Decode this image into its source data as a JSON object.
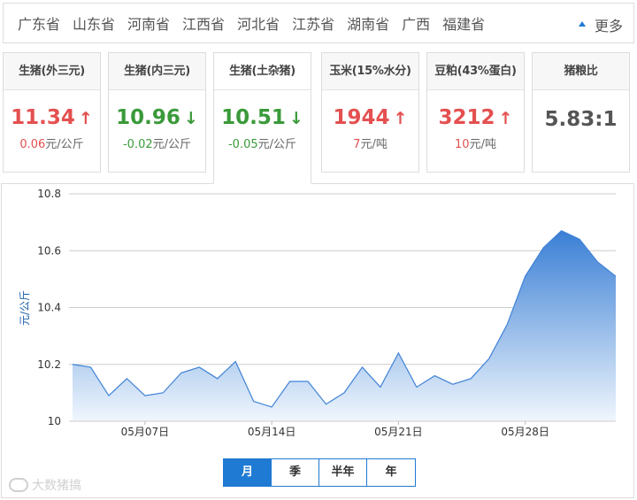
{
  "provinces": [
    "广东省",
    "山东省",
    "河南省",
    "江西省",
    "河北省",
    "江苏省",
    "湖南省",
    "广西",
    "福建省"
  ],
  "more_label": "更多",
  "cards": [
    {
      "title": "生猪(外三元)",
      "price": "11.34",
      "arrow": "↑",
      "direction": "up",
      "change_num": "0.06",
      "change_unit": "元/公斤"
    },
    {
      "title": "生猪(内三元)",
      "price": "10.96",
      "arrow": "↓",
      "direction": "down",
      "change_num": "-0.02",
      "change_unit": "元/公斤"
    },
    {
      "title": "生猪(土杂猪)",
      "price": "10.51",
      "arrow": "↓",
      "direction": "down",
      "change_num": "-0.05",
      "change_unit": "元/公斤",
      "active": true
    },
    {
      "title": "玉米(15%水分)",
      "price": "1944",
      "arrow": "↑",
      "direction": "up",
      "change_num": "7",
      "change_unit": "元/吨"
    },
    {
      "title": "豆粕(43%蛋白)",
      "price": "3212",
      "arrow": "↑",
      "direction": "up",
      "change_num": "10",
      "change_unit": "元/吨"
    },
    {
      "title": "猪粮比",
      "ratio": "5.83:1"
    }
  ],
  "chart_data": {
    "type": "area",
    "ylabel": "元/公斤",
    "ylim": [
      10,
      10.8
    ],
    "yticks": [
      "10",
      "10.2",
      "10.4",
      "10.6",
      "10.8"
    ],
    "xtick_labels": [
      "05月07日",
      "05月14日",
      "05月21日",
      "05月28日"
    ],
    "xtick_index": [
      4,
      11,
      18,
      25
    ],
    "series": [
      {
        "values": [
          10.2,
          10.19,
          10.09,
          10.15,
          10.09,
          10.1,
          10.17,
          10.19,
          10.15,
          10.21,
          10.07,
          10.05,
          10.14,
          10.14,
          10.06,
          10.1,
          10.19,
          10.12,
          10.24,
          10.12,
          10.16,
          10.13,
          10.15,
          10.22,
          10.34,
          10.51,
          10.61,
          10.67,
          10.64,
          10.56,
          10.51
        ]
      }
    ],
    "colors": {
      "line": "#3f82d6",
      "fill_top": "#3a7fd5",
      "fill_bottom": "#f0f6fd",
      "grid": "#cccccc"
    }
  },
  "periods": [
    "月",
    "季",
    "半年",
    "年"
  ],
  "active_period": "月",
  "watermark": "大数猪搞"
}
